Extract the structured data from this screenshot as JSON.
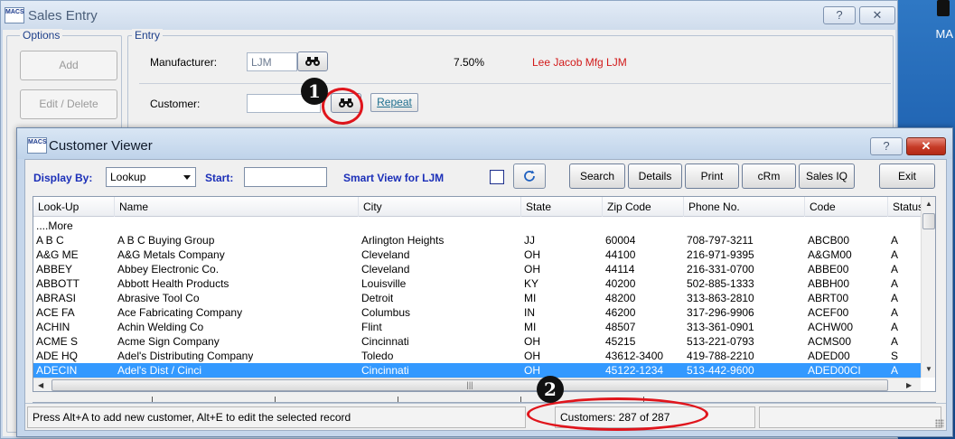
{
  "desktop": {
    "label": "MA"
  },
  "sales_entry": {
    "title": "Sales Entry",
    "logo_text": "MACS",
    "help_label": "?",
    "close_label": "✕",
    "options": {
      "title": "Options",
      "add_label": "Add",
      "edit_delete_label": "Edit / Delete"
    },
    "entry": {
      "title": "Entry",
      "manufacturer_label": "Manufacturer:",
      "manufacturer_value": "LJM",
      "commission": "7.50%",
      "manufacturer_name": "Lee Jacob Mfg  LJM",
      "customer_label": "Customer:",
      "customer_value": "",
      "repeat_label": "Repeat"
    }
  },
  "callouts": {
    "one": "1",
    "two": "2"
  },
  "customer_viewer": {
    "title": "Customer Viewer",
    "logo_text": "MACS",
    "help_label": "?",
    "close_label": "✕",
    "display_by_label": "Display By:",
    "display_by_value": "Lookup",
    "start_label": "Start:",
    "start_value": "",
    "smart_view_label": "Smart View for LJM",
    "smart_view_checked": false,
    "buttons": [
      "Search",
      "Details",
      "Print",
      "cRm",
      "Sales IQ",
      "Exit"
    ],
    "columns": [
      "Look-Up",
      "Name",
      "City",
      "State",
      "Zip Code",
      "Phone No.",
      "Code",
      "Status"
    ],
    "more_label": "....More",
    "rows": [
      [
        "A B C",
        "A B C Buying Group",
        "Arlington Heights",
        "JJ",
        "60004",
        "708-797-3211",
        "ABCB00",
        "A"
      ],
      [
        "A&G ME",
        "A&G Metals Company",
        "Cleveland",
        "OH",
        "44100",
        "216-971-9395",
        "A&GM00",
        "A"
      ],
      [
        "ABBEY",
        "Abbey Electronic Co.",
        "Cleveland",
        "OH",
        "44114",
        "216-331-0700",
        "ABBE00",
        "A"
      ],
      [
        "ABBOTT",
        "Abbott Health Products",
        "Louisville",
        "KY",
        "40200",
        "502-885-1333",
        "ABBH00",
        "A"
      ],
      [
        "ABRASI",
        "Abrasive Tool Co",
        "Detroit",
        "MI",
        "48200",
        "313-863-2810",
        "ABRT00",
        "A"
      ],
      [
        "ACE FA",
        "Ace Fabricating Company",
        "Columbus",
        "IN",
        "46200",
        "317-296-9906",
        "ACEF00",
        "A"
      ],
      [
        "ACHIN",
        "Achin Welding Co",
        "Flint",
        "MI",
        "48507",
        "313-361-0901",
        "ACHW00",
        "A"
      ],
      [
        "ACME S",
        "Acme Sign Company",
        "Cincinnati",
        "OH",
        "45215",
        "513-221-0793",
        "ACMS00",
        "A"
      ],
      [
        "ADE HQ",
        "Adel's Distributing Company",
        "Toledo",
        "OH",
        "43612-3400",
        "419-788-2210",
        "ADED00",
        "S"
      ],
      [
        "ADECIN",
        "Adel's Dist / Cinci",
        "Cincinnati",
        "OH",
        "45122-1234",
        "513-442-9600",
        "ADED00CI",
        "A"
      ]
    ],
    "selected_row": 9,
    "status_hint": "Press Alt+A to add new customer,   Alt+E to edit the selected record",
    "customers_count": "Customers: 287 of 287"
  },
  "colors": {
    "annotation_red": "#e0151c",
    "selection_blue": "#3399ff",
    "label_blue": "#1b2fb8",
    "manufacturer_red": "#d21a1a"
  }
}
